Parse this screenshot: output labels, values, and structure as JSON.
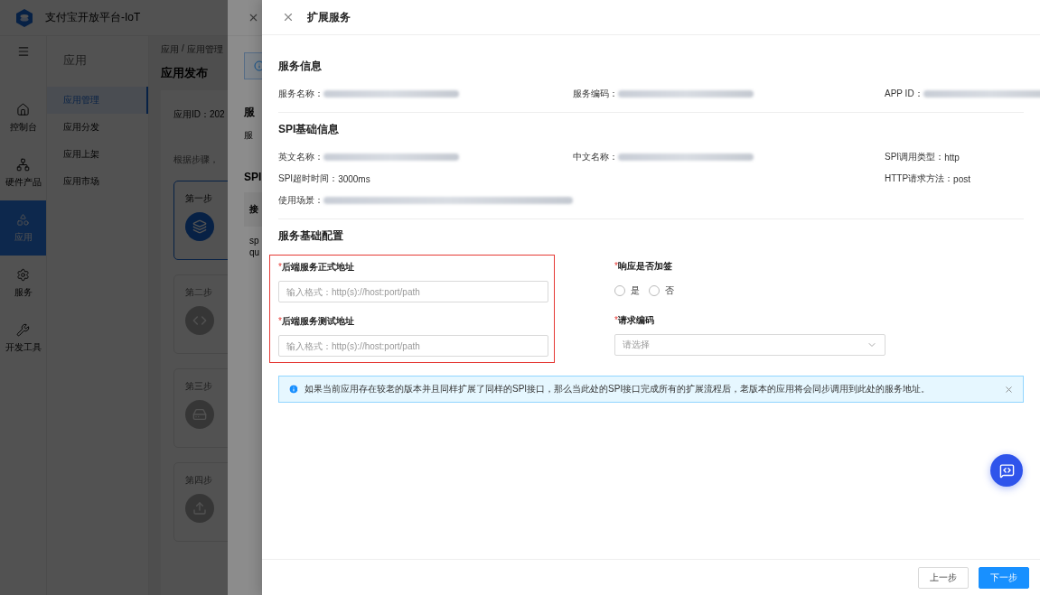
{
  "app": {
    "title": "支付宝开放平台-IoT",
    "rail": [
      {
        "label": "控制台",
        "selected": false
      },
      {
        "label": "硬件产品",
        "selected": false
      },
      {
        "label": "应用",
        "selected": true
      },
      {
        "label": "服务",
        "selected": false
      },
      {
        "label": "开发工具",
        "selected": false
      }
    ],
    "submenu": {
      "title": "应用",
      "items": [
        {
          "label": "应用管理",
          "selected": true
        },
        {
          "label": "应用分发",
          "selected": false
        },
        {
          "label": "应用上架",
          "selected": false
        },
        {
          "label": "应用市场",
          "selected": false
        }
      ]
    },
    "breadcrumb": [
      "应用",
      "/",
      "应用管理"
    ],
    "page_title": "应用发布",
    "app_id": "应用ID：202",
    "hint": "根据步骤，",
    "steps": [
      {
        "label": "第一步",
        "selected": true
      },
      {
        "label": "第二步",
        "selected": false
      },
      {
        "label": "第三步",
        "selected": false
      },
      {
        "label": "第四步",
        "selected": false
      }
    ]
  },
  "back_drawer": {
    "heading": "服",
    "line": "服",
    "spi": "SPI",
    "table_head": "接",
    "cells": [
      "sp",
      "qu"
    ]
  },
  "drawer": {
    "title": "扩展服务",
    "sections": [
      {
        "title": "服务信息",
        "rows": [
          [
            {
              "label": "服务名称：",
              "kind": "blurred"
            },
            {
              "label": "服务编码：",
              "kind": "blurred"
            },
            {
              "label": "APP ID：",
              "kind": "blurred"
            }
          ]
        ]
      },
      {
        "title": "SPI基础信息",
        "rows": [
          [
            {
              "label": "英文名称：",
              "kind": "blurred"
            },
            {
              "label": "中文名称：",
              "kind": "blurred"
            },
            {
              "label": "SPI调用类型：",
              "kind": "text",
              "value": "http"
            }
          ],
          [
            {
              "label": "SPI超时时间：",
              "kind": "text",
              "value": "3000ms"
            },
            null,
            {
              "label": "HTTP请求方法：",
              "kind": "text",
              "value": "post"
            }
          ],
          [
            {
              "label": "使用场景：",
              "kind": "blurred"
            }
          ]
        ]
      }
    ],
    "config_title": "服务基础配置",
    "left_fields": [
      {
        "mark": "*",
        "label": "后端服务正式地址",
        "placeholder": "输入格式：http(s)://host:port/path"
      },
      {
        "mark": "*",
        "label": "后端服务测试地址",
        "placeholder": "输入格式：http(s)://host:port/path"
      }
    ],
    "sign": {
      "mark": "*",
      "label": "响应是否加签",
      "options": [
        {
          "label": "是",
          "selected": false
        },
        {
          "label": "否",
          "selected": false
        }
      ]
    },
    "encoding": {
      "mark": "*",
      "label": "请求编码",
      "placeholder": "请选择"
    },
    "alert": "如果当前应用存在较老的版本并且同样扩展了同样的SPI接口，那么当此处的SPI接口完成所有的扩展流程后，老版本的应用将会同步调用到此处的服务地址。",
    "buttons": [
      {
        "label": "上一步",
        "kind": "default"
      },
      {
        "label": "下一步",
        "kind": "primary"
      }
    ]
  }
}
